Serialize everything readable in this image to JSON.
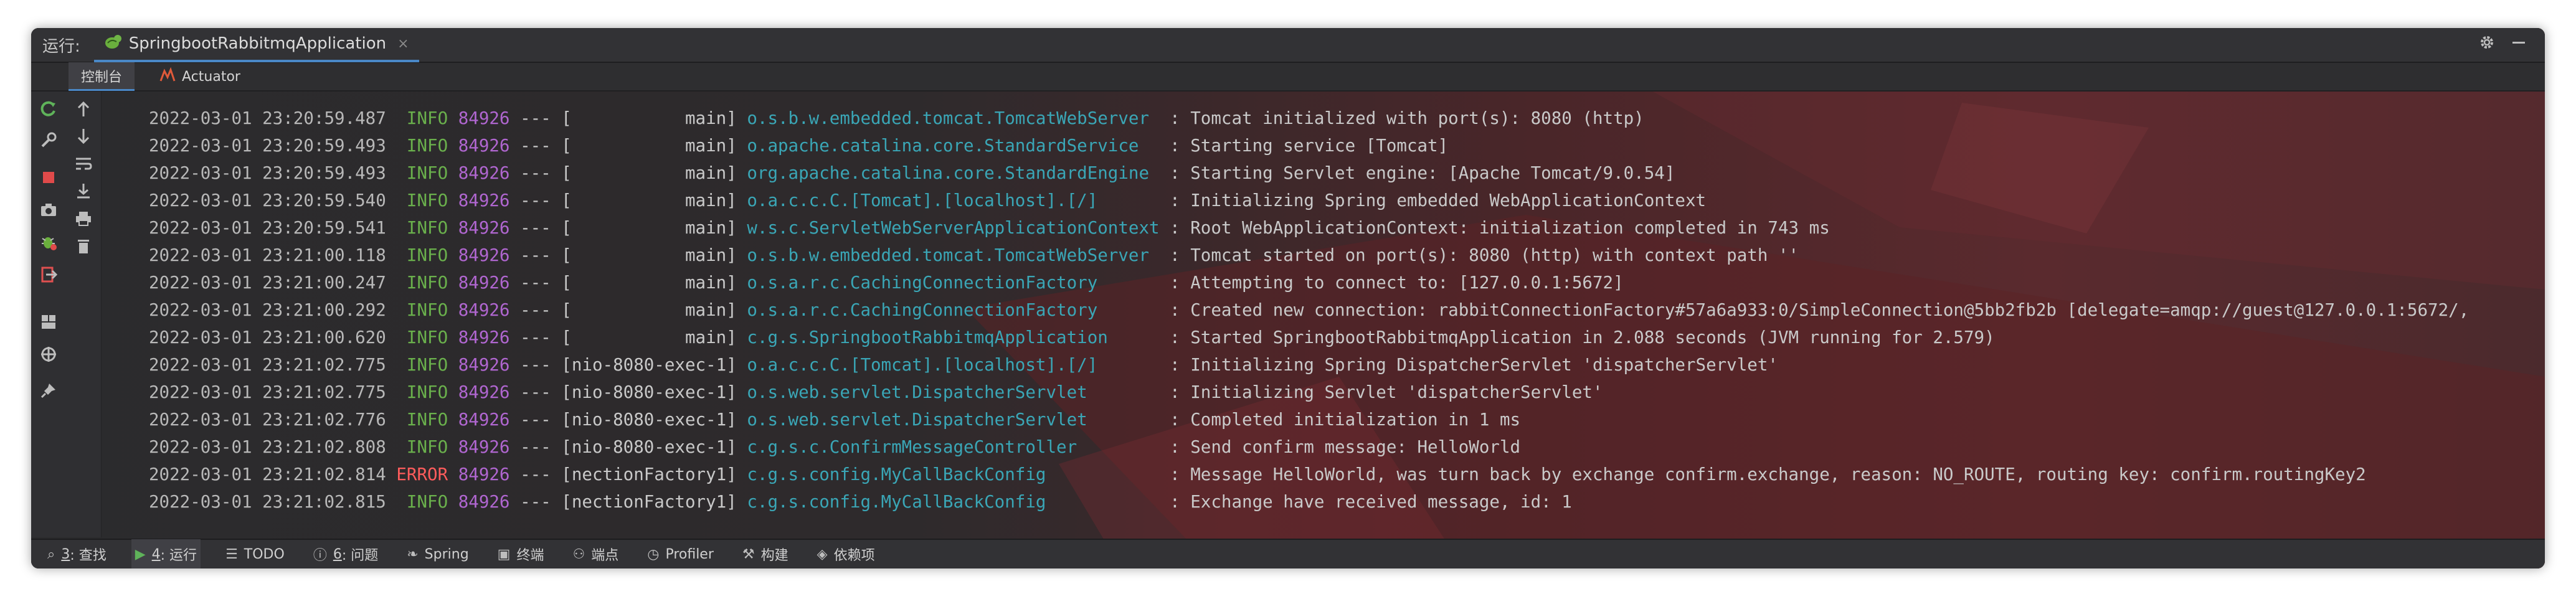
{
  "toolwindow": {
    "run_label": "运行:",
    "tab_name": "SpringbootRabbitmqApplication",
    "close": "×"
  },
  "subtabs": [
    {
      "label": "控制台",
      "icon": "console-icon",
      "active": true
    },
    {
      "label": "Actuator",
      "icon": "actuator-icon",
      "active": false
    }
  ],
  "log_lines": [
    {
      "ts": "2022-03-01 23:20:59.487",
      "level": "INFO",
      "pid": "84926",
      "sep": "---",
      "thread": "[           main]",
      "logger": "o.s.b.w.embedded.tomcat.TomcatWebServer",
      "msg": ": Tomcat initialized with port(s): 8080 (http)"
    },
    {
      "ts": "2022-03-01 23:20:59.493",
      "level": "INFO",
      "pid": "84926",
      "sep": "---",
      "thread": "[           main]",
      "logger": "o.apache.catalina.core.StandardService",
      "msg": ": Starting service [Tomcat]"
    },
    {
      "ts": "2022-03-01 23:20:59.493",
      "level": "INFO",
      "pid": "84926",
      "sep": "---",
      "thread": "[           main]",
      "logger": "org.apache.catalina.core.StandardEngine",
      "msg": ": Starting Servlet engine: [Apache Tomcat/9.0.54]"
    },
    {
      "ts": "2022-03-01 23:20:59.540",
      "level": "INFO",
      "pid": "84926",
      "sep": "---",
      "thread": "[           main]",
      "logger": "o.a.c.c.C.[Tomcat].[localhost].[/]",
      "msg": ": Initializing Spring embedded WebApplicationContext"
    },
    {
      "ts": "2022-03-01 23:20:59.541",
      "level": "INFO",
      "pid": "84926",
      "sep": "---",
      "thread": "[           main]",
      "logger": "w.s.c.ServletWebServerApplicationContext",
      "msg": ": Root WebApplicationContext: initialization completed in 743 ms"
    },
    {
      "ts": "2022-03-01 23:21:00.118",
      "level": "INFO",
      "pid": "84926",
      "sep": "---",
      "thread": "[           main]",
      "logger": "o.s.b.w.embedded.tomcat.TomcatWebServer",
      "msg": ": Tomcat started on port(s): 8080 (http) with context path ''"
    },
    {
      "ts": "2022-03-01 23:21:00.247",
      "level": "INFO",
      "pid": "84926",
      "sep": "---",
      "thread": "[           main]",
      "logger": "o.s.a.r.c.CachingConnectionFactory",
      "msg": ": Attempting to connect to: [127.0.0.1:5672]"
    },
    {
      "ts": "2022-03-01 23:21:00.292",
      "level": "INFO",
      "pid": "84926",
      "sep": "---",
      "thread": "[           main]",
      "logger": "o.s.a.r.c.CachingConnectionFactory",
      "msg": ": Created new connection: rabbitConnectionFactory#57a6a933:0/SimpleConnection@5bb2fb2b [delegate=amqp://guest@127.0.0.1:5672/,"
    },
    {
      "ts": "2022-03-01 23:21:00.620",
      "level": "INFO",
      "pid": "84926",
      "sep": "---",
      "thread": "[           main]",
      "logger": "c.g.s.SpringbootRabbitmqApplication",
      "msg": ": Started SpringbootRabbitmqApplication in 2.088 seconds (JVM running for 2.579)"
    },
    {
      "ts": "2022-03-01 23:21:02.775",
      "level": "INFO",
      "pid": "84926",
      "sep": "---",
      "thread": "[nio-8080-exec-1]",
      "logger": "o.a.c.c.C.[Tomcat].[localhost].[/]",
      "msg": ": Initializing Spring DispatcherServlet 'dispatcherServlet'"
    },
    {
      "ts": "2022-03-01 23:21:02.775",
      "level": "INFO",
      "pid": "84926",
      "sep": "---",
      "thread": "[nio-8080-exec-1]",
      "logger": "o.s.web.servlet.DispatcherServlet",
      "msg": ": Initializing Servlet 'dispatcherServlet'"
    },
    {
      "ts": "2022-03-01 23:21:02.776",
      "level": "INFO",
      "pid": "84926",
      "sep": "---",
      "thread": "[nio-8080-exec-1]",
      "logger": "o.s.web.servlet.DispatcherServlet",
      "msg": ": Completed initialization in 1 ms"
    },
    {
      "ts": "2022-03-01 23:21:02.808",
      "level": "INFO",
      "pid": "84926",
      "sep": "---",
      "thread": "[nio-8080-exec-1]",
      "logger": "c.g.s.c.ConfirmMessageController",
      "msg": ": Send confirm message: HelloWorld"
    },
    {
      "ts": "2022-03-01 23:21:02.814",
      "level": "ERROR",
      "pid": "84926",
      "sep": "---",
      "thread": "[nectionFactory1]",
      "logger": "c.g.s.config.MyCallBackConfig",
      "msg": ": Message HelloWorld, was turn back by exchange confirm.exchange, reason: NO_ROUTE, routing key: confirm.routingKey2"
    },
    {
      "ts": "2022-03-01 23:21:02.815",
      "level": "INFO",
      "pid": "84926",
      "sep": "---",
      "thread": "[nectionFactory1]",
      "logger": "c.g.s.config.MyCallBackConfig",
      "msg": ": Exchange have received message, id: 1"
    }
  ],
  "statusbar": [
    {
      "key": "3",
      "label": ": 查找",
      "icon": "search-icon",
      "active": false
    },
    {
      "key": "4",
      "label": ": 运行",
      "icon": "run-icon",
      "active": true
    },
    {
      "key": "",
      "label": "TODO",
      "icon": "todo-icon",
      "active": false
    },
    {
      "key": "6",
      "label": ": 问题",
      "icon": "problems-icon",
      "active": false
    },
    {
      "key": "",
      "label": "Spring",
      "icon": "spring-icon",
      "active": false
    },
    {
      "key": "",
      "label": "终端",
      "icon": "terminal-icon",
      "active": false
    },
    {
      "key": "",
      "label": "端点",
      "icon": "endpoints-icon",
      "active": false
    },
    {
      "key": "",
      "label": "Profiler",
      "icon": "profiler-icon",
      "active": false
    },
    {
      "key": "",
      "label": "构建",
      "icon": "build-icon",
      "active": false
    },
    {
      "key": "",
      "label": "依赖项",
      "icon": "dependencies-icon",
      "active": false
    }
  ],
  "colors": {
    "info": "#6ab04c",
    "error": "#ff5c5c",
    "pid": "#b066d0",
    "logger": "#3aa6b6",
    "accent": "#4a88c7"
  }
}
